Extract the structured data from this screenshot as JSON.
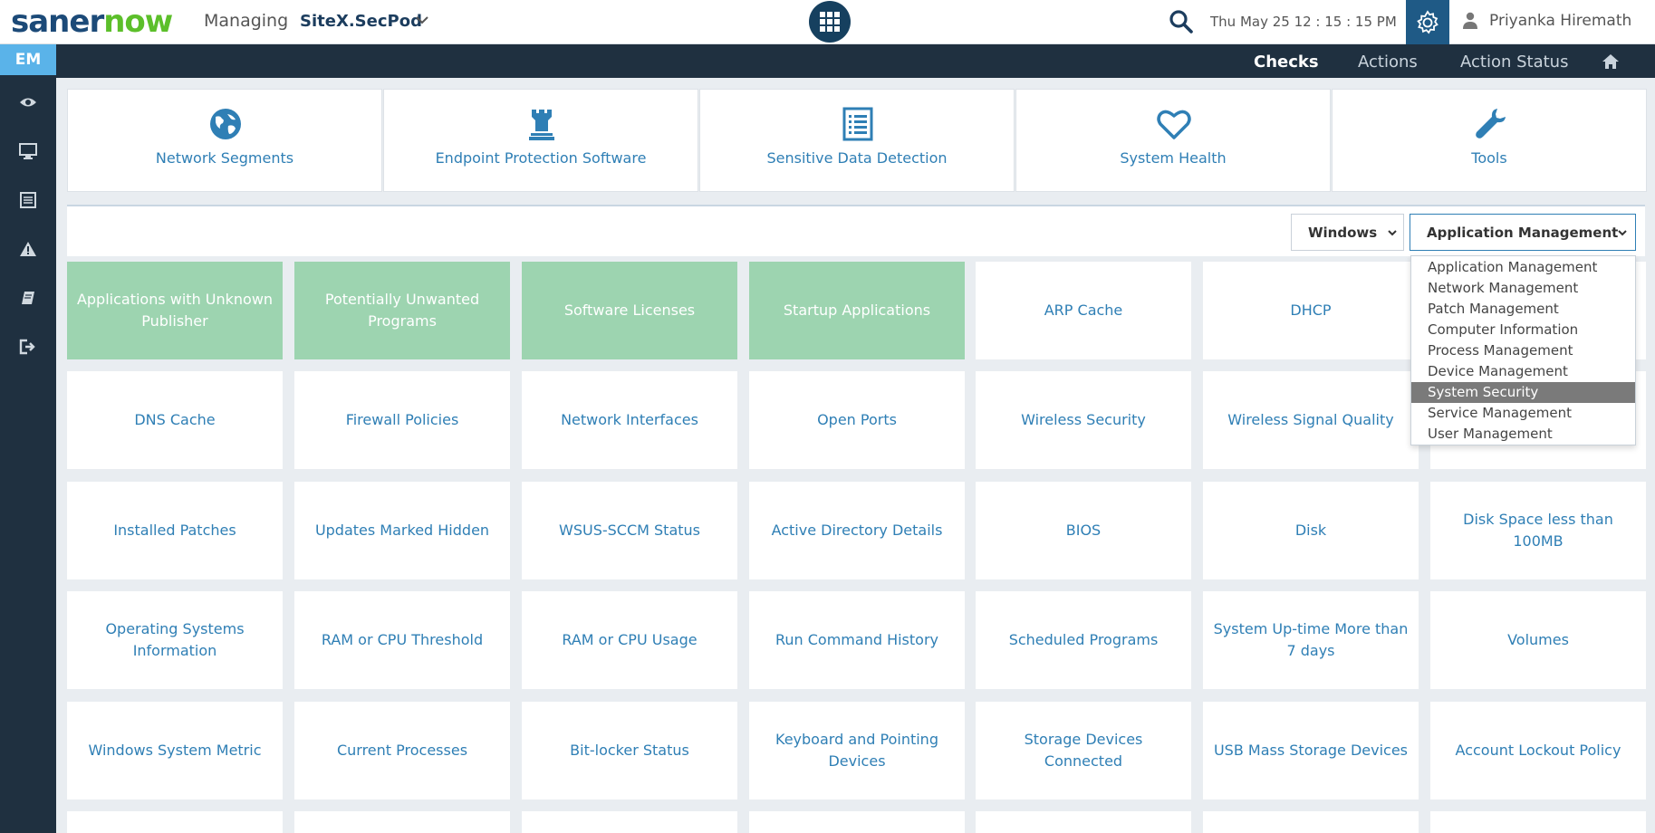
{
  "header": {
    "logo_part1": "saner",
    "logo_part2": "now",
    "managing_label": "Managing",
    "site_name": "SiteX.SecPod",
    "datetime": "Thu May 25   12 : 15 : 15 PM",
    "user_name": "Priyanka Hiremath",
    "colors": {
      "brand_dark": "#1c4a78",
      "brand_green": "#5cbf2a",
      "settings_bg": "#1f5a86"
    }
  },
  "sidebar": {
    "badge": "EM",
    "icons": [
      "eye-icon",
      "monitor-icon",
      "list-icon",
      "warning-icon",
      "book-icon",
      "logout-icon"
    ]
  },
  "nav": {
    "items": [
      "Checks",
      "Actions",
      "Action Status"
    ],
    "active": "Checks",
    "home_icon": "home-icon"
  },
  "categories": [
    {
      "label": "Network Segments",
      "icon": "globe-icon"
    },
    {
      "label": "Endpoint Protection Software",
      "icon": "castle-icon"
    },
    {
      "label": "Sensitive Data Detection",
      "icon": "document-list-icon"
    },
    {
      "label": "System Health",
      "icon": "heart-icon"
    },
    {
      "label": "Tools",
      "icon": "wrench-icon"
    }
  ],
  "filters": {
    "os": "Windows",
    "category": "Application Management",
    "category_options": [
      "Application Management",
      "Network Management",
      "Patch Management",
      "Computer Information",
      "Process Management",
      "Device Management",
      "System Security",
      "Service Management",
      "User Management"
    ],
    "highlighted_option": "System Security"
  },
  "tiles": [
    [
      {
        "label": "Applications with Unknown Publisher",
        "highlight": true
      },
      {
        "label": "Potentially Unwanted Programs",
        "highlight": true
      },
      {
        "label": "Software Licenses",
        "highlight": true
      },
      {
        "label": "Startup Applications",
        "highlight": true
      },
      {
        "label": "ARP Cache"
      },
      {
        "label": "DHCP"
      }
    ],
    [
      {
        "label": "DNS Cache"
      },
      {
        "label": "Firewall Policies"
      },
      {
        "label": "Network Interfaces"
      },
      {
        "label": "Open Ports"
      },
      {
        "label": "Wireless Security"
      },
      {
        "label": "Wireless Signal Quality"
      }
    ],
    [
      {
        "label": "Installed Patches"
      },
      {
        "label": "Updates Marked Hidden"
      },
      {
        "label": "WSUS-SCCM Status"
      },
      {
        "label": "Active Directory Details"
      },
      {
        "label": "BIOS"
      },
      {
        "label": "Disk"
      },
      {
        "label": "Disk Space less than 100MB"
      }
    ],
    [
      {
        "label": "Operating Systems Information"
      },
      {
        "label": "RAM or CPU Threshold"
      },
      {
        "label": "RAM or CPU Usage"
      },
      {
        "label": "Run Command History"
      },
      {
        "label": "Scheduled Programs"
      },
      {
        "label": "System Up-time More than 7 days"
      },
      {
        "label": "Volumes"
      }
    ],
    [
      {
        "label": "Windows System Metric"
      },
      {
        "label": "Current Processes"
      },
      {
        "label": "Bit-locker Status"
      },
      {
        "label": "Keyboard and Pointing Devices"
      },
      {
        "label": "Storage Devices Connected"
      },
      {
        "label": "USB Mass Storage Devices"
      },
      {
        "label": "Account Lockout Policy"
      }
    ]
  ]
}
